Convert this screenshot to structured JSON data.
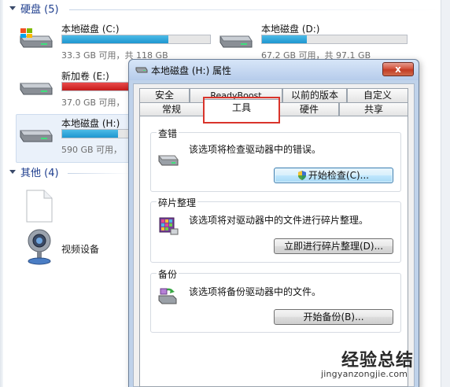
{
  "explorer": {
    "hard_disk_group": {
      "label": "硬盘 (5)"
    },
    "drives": [
      {
        "name": "本地磁盘 (C:)",
        "size_text": "33.3 GB 可用，共 118 GB",
        "used_fraction": 0.72,
        "status_color": "#1e96d0"
      },
      {
        "name": "本地磁盘 (D:)",
        "size_text": "67.2 GB 可用，共 97.1 GB",
        "used_fraction": 0.31,
        "status_color": "#1e96d0"
      },
      {
        "name": "新加卷 (E:)",
        "size_text": "37.0 GB 可用，",
        "used_fraction": 0.93,
        "status_color": "#c51b1b"
      },
      {
        "name": "本地磁盘 (H:)",
        "size_text": "590 GB 可用，",
        "used_fraction": 0.38,
        "status_color": "#1e96d0"
      }
    ],
    "other_group": {
      "label": "其他 (4)"
    },
    "other_items": [
      {
        "name": "",
        "icon": "blank-file-icon"
      },
      {
        "name": "视频设备",
        "icon": "webcam-icon"
      }
    ]
  },
  "dialog": {
    "title": "本地磁盘 (H:) 属性",
    "close_label": "x",
    "tabs_back": [
      "安全",
      "ReadyBoost",
      "以前的版本",
      "自定义"
    ],
    "tabs_front": [
      "常规",
      "工具",
      "硬件",
      "共享"
    ],
    "active_tab": "工具",
    "sections": {
      "error_check": {
        "title": "查错",
        "description": "该选项将检查驱动器中的错误。",
        "button": "开始检查(C)..."
      },
      "defrag": {
        "title": "碎片整理",
        "description": "该选项将对驱动器中的文件进行碎片整理。",
        "button": "立即进行碎片整理(D)..."
      },
      "backup": {
        "title": "备份",
        "description": "该选项将备份驱动器中的文件。",
        "button": "开始备份(B)..."
      }
    }
  },
  "watermark": {
    "brand": "经验总结",
    "url": "jingyanzongjie.com"
  }
}
